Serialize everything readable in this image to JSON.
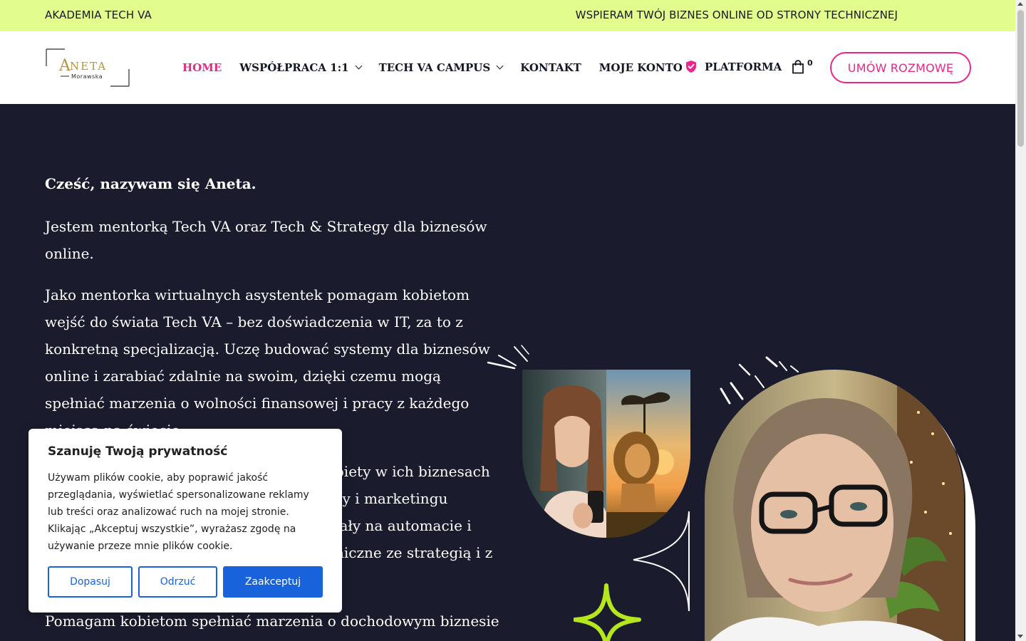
{
  "topbar": {
    "left_text": "AKADEMIA TECH VA",
    "right_text": "WSPIERAM TWÓJ BIZNES ONLINE OD STRONY TECHNICZNEJ"
  },
  "logo": {
    "name": "ANETA",
    "sub": "Morawska"
  },
  "nav": {
    "items": [
      {
        "label": "HOME",
        "active": true
      },
      {
        "label": "WSPÓŁPRACA 1:1",
        "dropdown": true
      },
      {
        "label": "TECH VA CAMPUS",
        "dropdown": true
      },
      {
        "label": "KONTAKT"
      },
      {
        "label": "MOJE KONTO"
      }
    ],
    "platform_label": "PLATFORMA",
    "cart_count": "0",
    "cta_label": "UMÓW ROZMOWĘ"
  },
  "hero": {
    "intro": "Cześć, nazywam się Aneta.",
    "p1": "Jestem mentorką Tech VA oraz Tech & Strategy dla biznesów online.",
    "p2": "Jako mentorka wirtualnych asystentek pomagam kobietom wejść do świata Tech VA – bez doświadczenia w IT, za to z konkretną specjalizacją. Uczę budować systemy dla biznesów online i zarabiać zdalnie na swoim, dzięki czemu mogą spełniać marzenia o wolności finansowej i pracy z każdego miejsca na świecie.",
    "p3": "biety w ich biznesach\nży i marketingu\nłały na automacie i\nniczne ze strategią i z",
    "p4": "Pomagam kobietom spełniać marzenia o dochodowym biznesie"
  },
  "cookie": {
    "title": "Szanuję Twoją prywatność",
    "text": "Używam plików cookie, aby poprawić jakość przeglądania, wyświetlać spersonalizowane reklamy lub treści oraz analizować ruch na mojej stronie. Klikając „Akceptuj wszystkie”, wyrażasz zgodę na używanie przeze mnie plików cookie.",
    "btn_customize": "Dopasuj",
    "btn_reject": "Odrzuć",
    "btn_accept": "Zaakceptuj"
  },
  "colors": {
    "topbar_bg": "#e2fc8e",
    "hero_bg": "#1a1c2d",
    "accent_pink": "#e8268b",
    "accent_lime": "#b6e61c",
    "cookie_blue": "#1863dc"
  },
  "icons": [
    "shield-check-icon",
    "shopping-bag-icon",
    "chevron-down-icon",
    "sparkle-star-icon"
  ]
}
